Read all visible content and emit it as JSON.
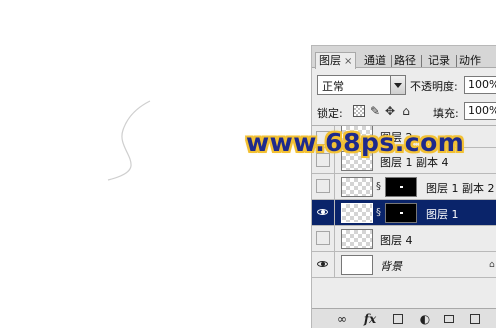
{
  "watermark": {
    "text": "www.68ps.com"
  },
  "layers_panel": {
    "tabs": [
      {
        "label": "图层",
        "close": "×",
        "active": true
      },
      {
        "label": "通道",
        "active": false
      },
      {
        "label": "路径",
        "active": false
      },
      {
        "label": "记录",
        "active": false
      },
      {
        "label": "动作",
        "active": false
      }
    ],
    "blend_mode": "正常",
    "opacity_label": "不透明度:",
    "opacity_value": "100%",
    "lock_label": "锁定:",
    "fill_label": "填充:",
    "fill_value": "100%",
    "layers": [
      {
        "name": "图层 2",
        "visible": false,
        "selected": false,
        "has_mask": false,
        "italic": false
      },
      {
        "name": "图层 1 副本 4",
        "visible": false,
        "selected": false,
        "has_mask": false,
        "italic": false
      },
      {
        "name": "图层 1 副本 2",
        "visible": false,
        "selected": false,
        "has_mask": true,
        "italic": false
      },
      {
        "name": "图层 1",
        "visible": true,
        "selected": true,
        "has_mask": true,
        "italic": false
      },
      {
        "name": "图层 4",
        "visible": false,
        "selected": false,
        "has_mask": false,
        "italic": false
      },
      {
        "name": "背景",
        "visible": true,
        "selected": false,
        "has_mask": false,
        "italic": true,
        "locked": true
      }
    ],
    "footer_icons": [
      "link-icon",
      "fx-icon",
      "mask-icon",
      "adjustment-icon",
      "folder-icon",
      "new-layer-icon"
    ],
    "footer_fx_label": "fx",
    "colors": {
      "selection": "#0a246a",
      "panel_bg": "#ececec",
      "watermark_fill": "#1e2a8c",
      "watermark_stroke": "#f2c033"
    }
  }
}
